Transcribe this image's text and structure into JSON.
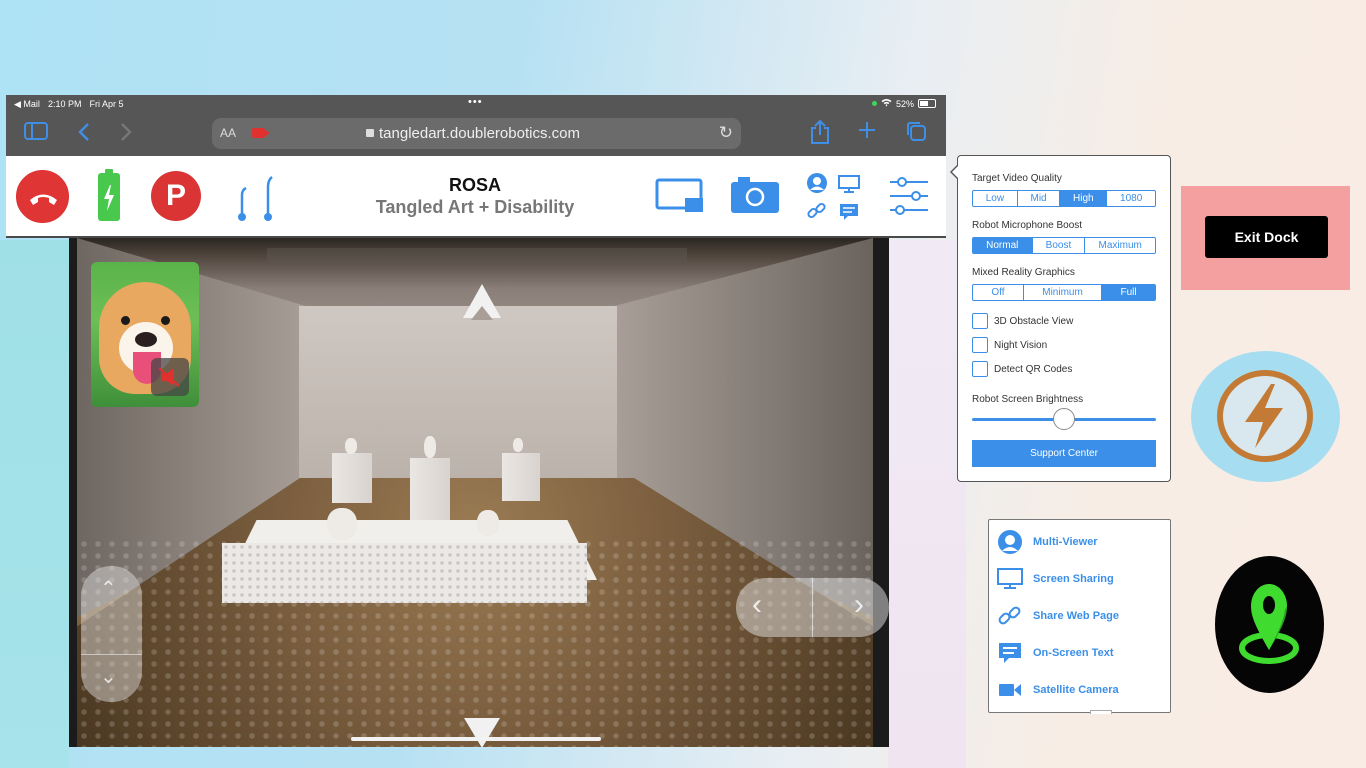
{
  "status_bar": {
    "back_app": "◀ Mail",
    "time": "2:10 PM",
    "date": "Fri Apr 5",
    "dots": "•••",
    "battery": "52%"
  },
  "browser": {
    "aa_label": "AA",
    "url": "tangledart.doublerobotics.com"
  },
  "toolbar": {
    "robot_name": "ROSA",
    "robot_location": "Tangled Art + Disability",
    "park_label": "P"
  },
  "settings": {
    "video_quality": {
      "label": "Target Video Quality",
      "options": [
        "Low",
        "Mid",
        "High",
        "1080"
      ],
      "selected": "High"
    },
    "mic_boost": {
      "label": "Robot Microphone Boost",
      "options": [
        "Normal",
        "Boost",
        "Maximum"
      ],
      "selected": "Normal"
    },
    "mixed_reality": {
      "label": "Mixed Reality Graphics",
      "options": [
        "Off",
        "Minimum",
        "Full"
      ],
      "selected": "Full"
    },
    "checkboxes": [
      {
        "label": "3D Obstacle View",
        "checked": false
      },
      {
        "label": "Night Vision",
        "checked": false
      },
      {
        "label": "Detect QR Codes",
        "checked": false
      }
    ],
    "brightness": {
      "label": "Robot Screen Brightness",
      "value_fraction": 0.5
    },
    "support_label": "Support Center"
  },
  "menu": {
    "items": [
      {
        "label": "Multi-Viewer",
        "icon": "person-icon"
      },
      {
        "label": "Screen Sharing",
        "icon": "monitor-icon"
      },
      {
        "label": "Share Web Page",
        "icon": "link-icon"
      },
      {
        "label": "On-Screen Text",
        "icon": "message-icon"
      },
      {
        "label": "Satellite Camera",
        "icon": "video-camera-icon"
      }
    ]
  },
  "exit_dock": {
    "label": "Exit Dock"
  },
  "colors": {
    "accent": "#3b8fe8",
    "hangup": "#e03535",
    "battery": "#49c84e",
    "exit_dock_bg": "#f4a0a0",
    "charge_ring": "#c27a34",
    "location_pin": "#3fdc2f"
  }
}
